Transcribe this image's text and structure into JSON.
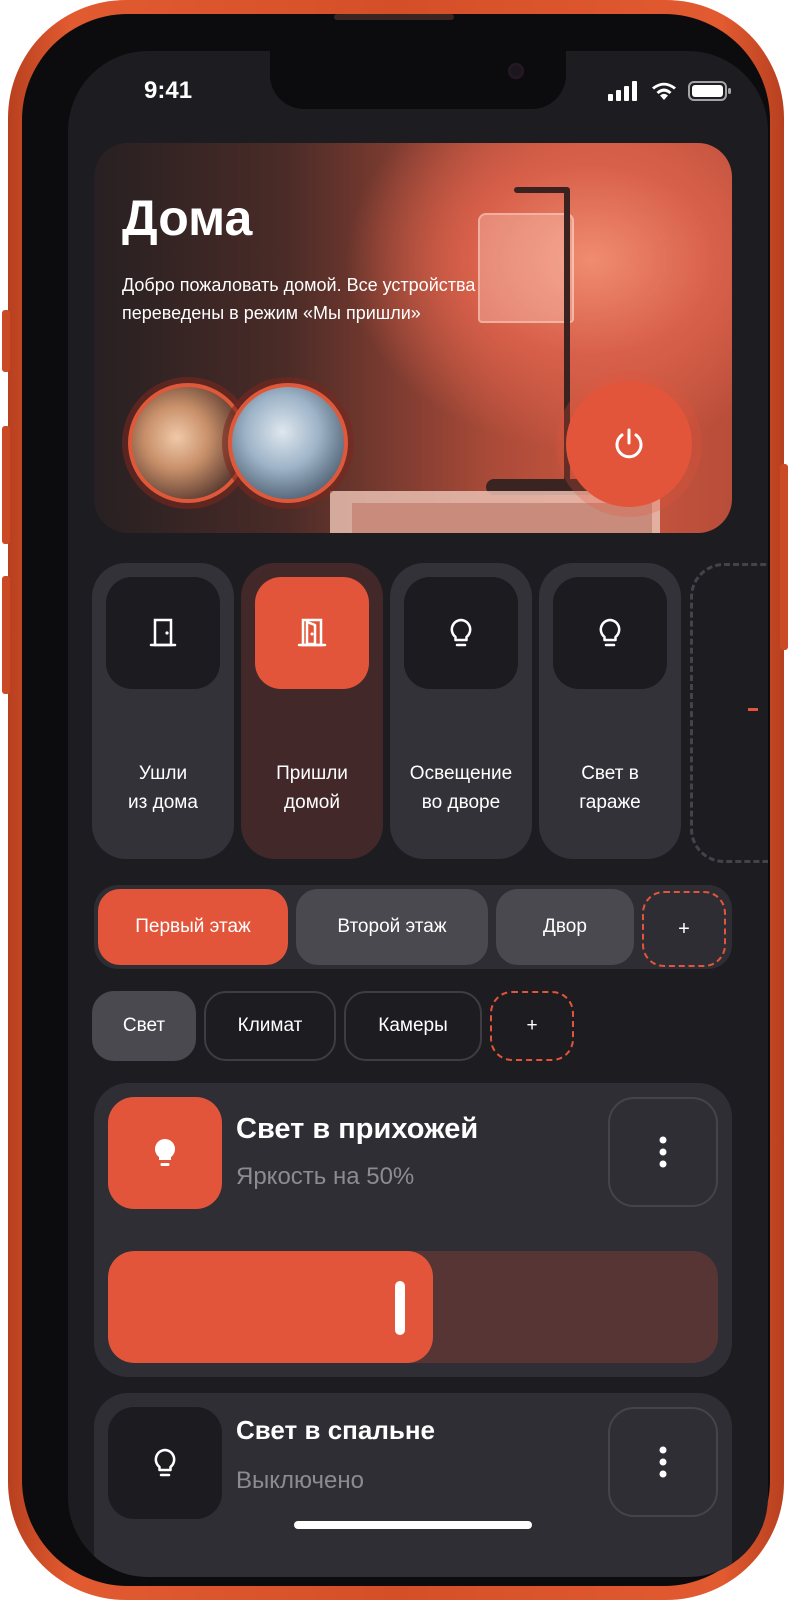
{
  "status_bar": {
    "time": "9:41"
  },
  "hero": {
    "title": "Дома",
    "description": "Добро пожаловать домой. Все устройства переведены в режим «Мы пришли»"
  },
  "scenes": [
    {
      "label": "Ушли\nиз дома",
      "icon": "door-closed-icon",
      "active": false
    },
    {
      "label": "Пришли\nдомой",
      "icon": "door-open-icon",
      "active": true
    },
    {
      "label": "Освещение\nво дворе",
      "icon": "bulb-icon",
      "active": false
    },
    {
      "label": "Свет в\nгараже",
      "icon": "bulb-icon",
      "active": false
    }
  ],
  "floors": {
    "items": [
      "Первый этаж",
      "Второй этаж",
      "Двор"
    ],
    "selected": "Первый этаж",
    "add_label": "+"
  },
  "categories": {
    "items": [
      "Свет",
      "Климат",
      "Камеры"
    ],
    "selected": "Свет",
    "add_label": "+"
  },
  "devices": [
    {
      "title": "Свет в прихожей",
      "subtitle": "Яркость на 50%",
      "on": true,
      "brightness": 0.5
    },
    {
      "title": "Свет в спальне",
      "subtitle": "Выключено",
      "on": false
    }
  ],
  "colors": {
    "accent": "#e2553a",
    "background": "#1d1c21",
    "card": "#2f2e34"
  }
}
